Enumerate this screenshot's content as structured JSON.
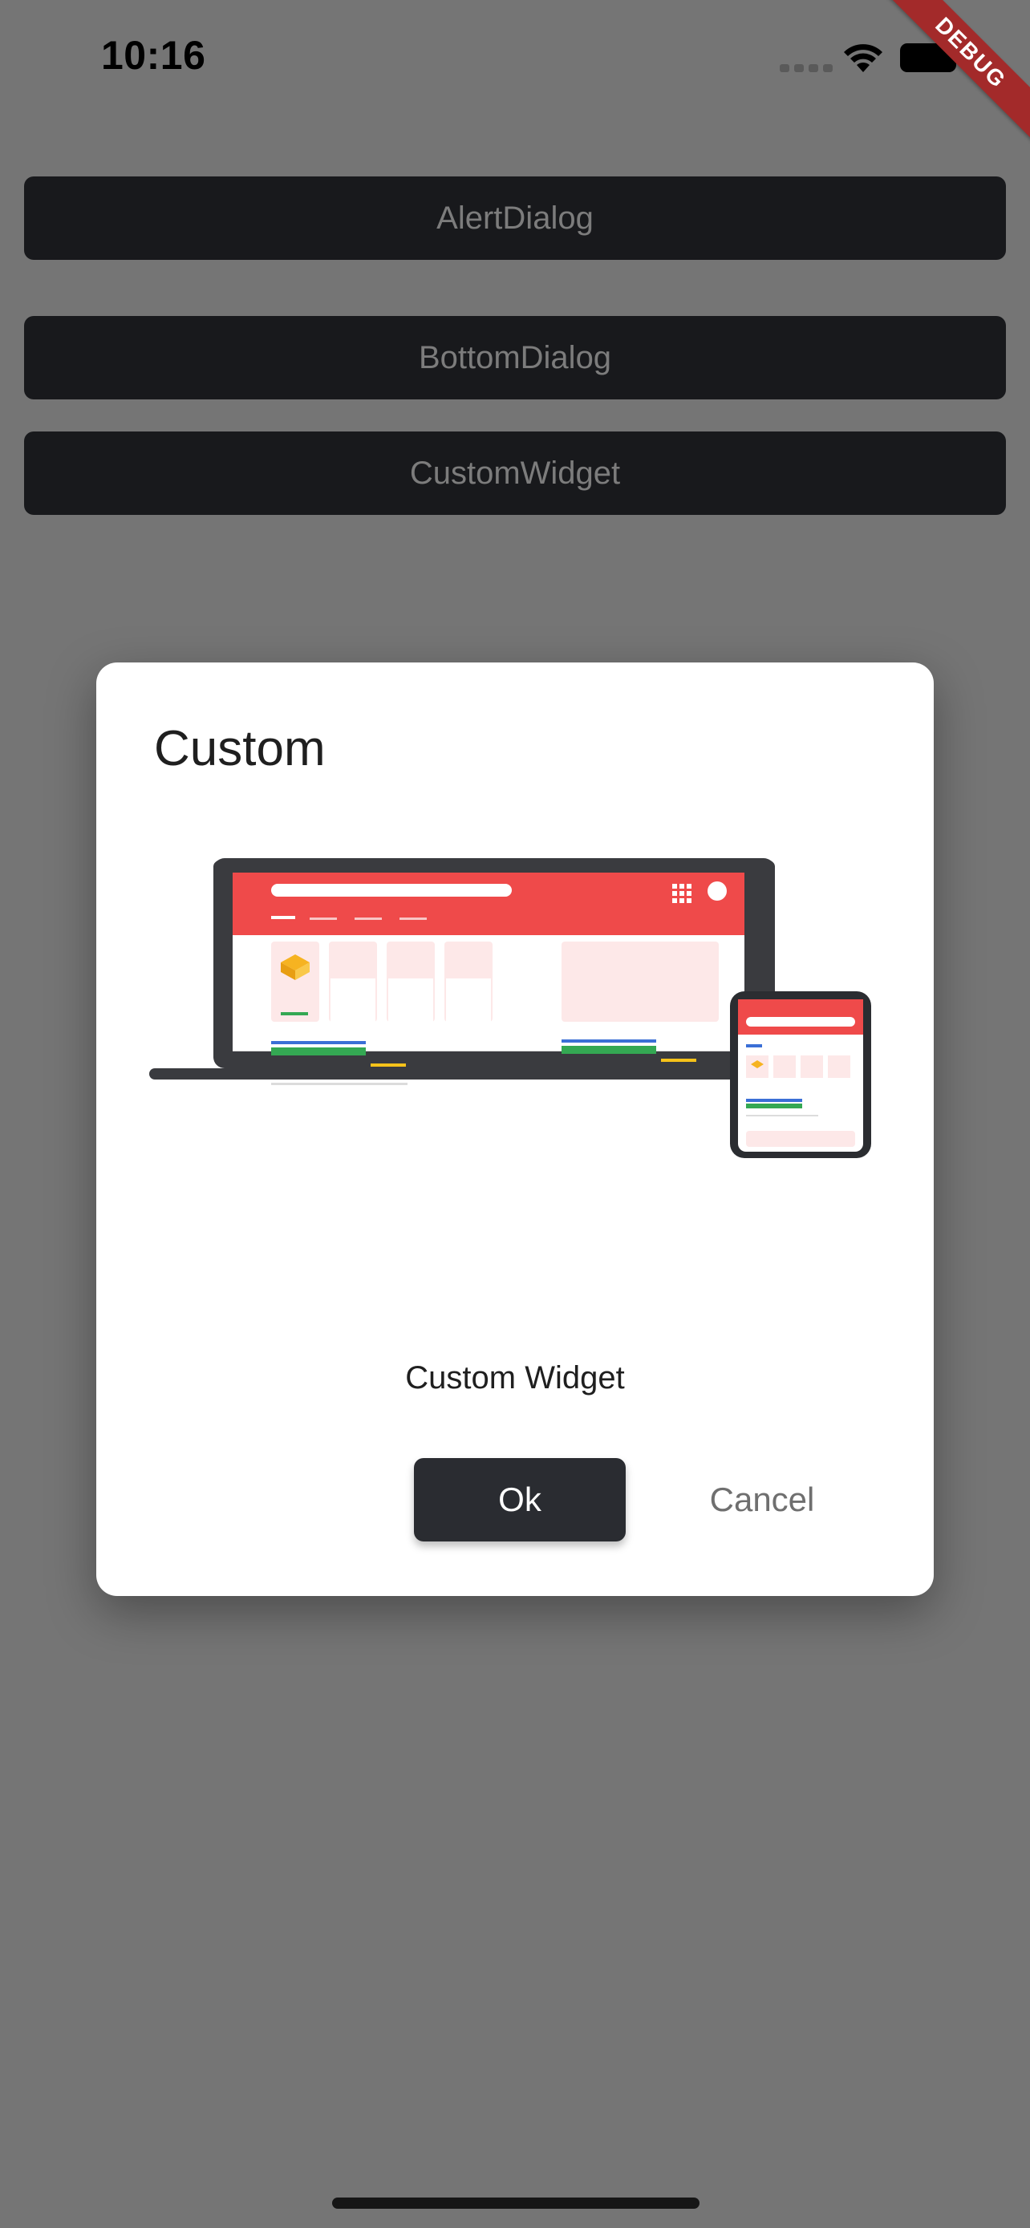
{
  "status_bar": {
    "time": "10:16"
  },
  "debug_banner": {
    "label": "DEBUG"
  },
  "buttons": [
    {
      "label": "AlertDialog"
    },
    {
      "label": "BottomDialog"
    },
    {
      "label": "CustomWidget"
    }
  ],
  "dialog": {
    "title": "Custom",
    "message": "Custom Widget",
    "ok_label": "Ok",
    "cancel_label": "Cancel"
  },
  "colors": {
    "scrim": "#757575",
    "button_bg": "#18191c",
    "accent_red": "#ef4a4a",
    "ok_bg": "#2a2c31"
  }
}
